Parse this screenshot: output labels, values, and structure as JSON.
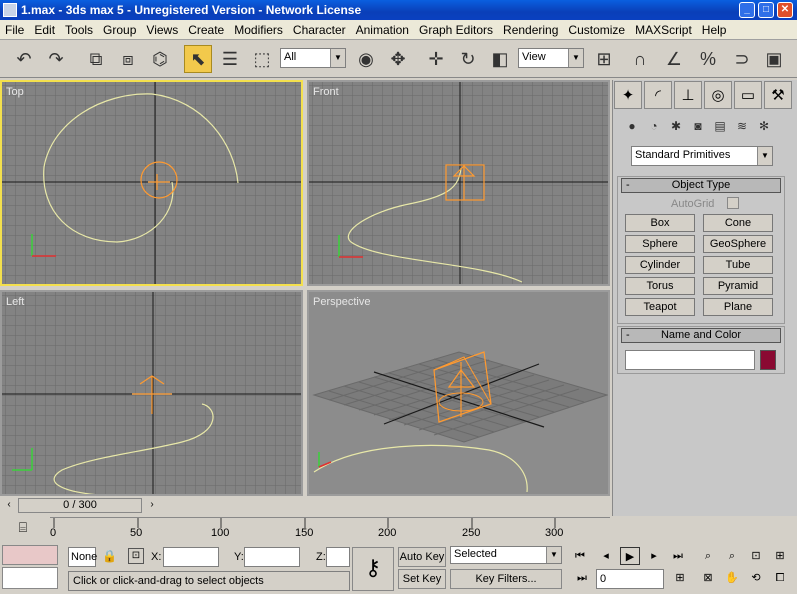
{
  "window": {
    "title": "1.max - 3ds max 5 - Unregistered Version - Network License"
  },
  "menu": [
    "File",
    "Edit",
    "Tools",
    "Group",
    "Views",
    "Create",
    "Modifiers",
    "Character",
    "Animation",
    "Graph Editors",
    "Rendering",
    "Customize",
    "MAXScript",
    "Help"
  ],
  "toolbar": {
    "selection_filter": "All",
    "coord_system": "View"
  },
  "viewports": {
    "top": "Top",
    "front": "Front",
    "left": "Left",
    "perspective": "Perspective"
  },
  "command_panel": {
    "category": "Standard Primitives",
    "object_type": "Object Type",
    "autogrid": "AutoGrid",
    "buttons": [
      "Box",
      "Cone",
      "Sphere",
      "GeoSphere",
      "Cylinder",
      "Tube",
      "Torus",
      "Pyramid",
      "Teapot",
      "Plane"
    ],
    "name_color": "Name and Color",
    "color": "#8a0a32"
  },
  "timeline": {
    "slider": "0 / 300",
    "ticks": [
      "0",
      "50",
      "100",
      "150",
      "200",
      "250",
      "300"
    ]
  },
  "status": {
    "selection": "None",
    "x_label": "X:",
    "y_label": "Y:",
    "z_label": "Z:",
    "prompt": "Click or click-and-drag to select objects",
    "auto_key": "Auto Key",
    "set_key": "Set Key",
    "key_mode": "Selected",
    "key_filters": "Key Filters...",
    "frame": "0"
  }
}
